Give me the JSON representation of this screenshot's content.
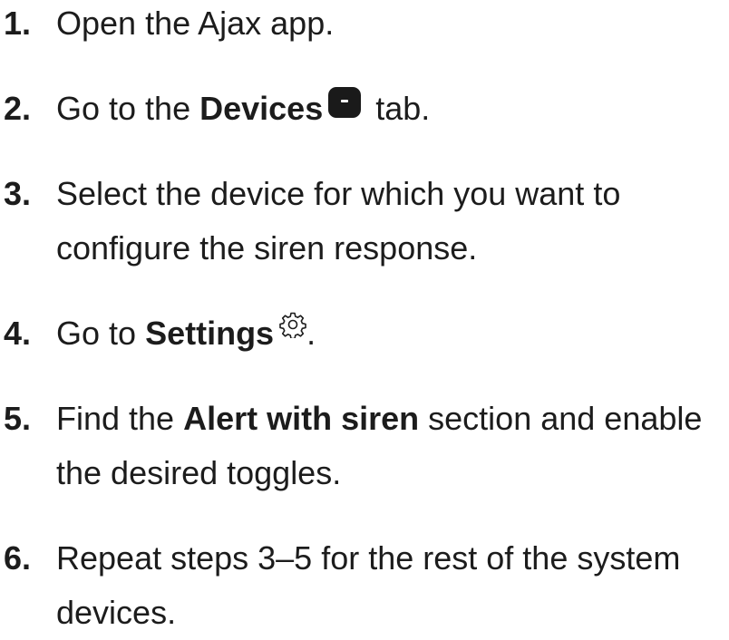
{
  "steps": [
    {
      "number": "1.",
      "text": "Open the Ajax app."
    },
    {
      "number": "2.",
      "before": "Go to the ",
      "bold": "Devices",
      "icon": "devices-tab-icon",
      "after": " tab."
    },
    {
      "number": "3.",
      "line1": "Select the device for which you want to",
      "line2": "configure the siren response."
    },
    {
      "number": "4.",
      "before": "Go to ",
      "bold": "Settings",
      "icon": "gear-icon",
      "after": "."
    },
    {
      "number": "5.",
      "before": "Find the ",
      "bold": "Alert with siren",
      "after_line1": " section and enable",
      "line2": "the desired toggles."
    },
    {
      "number": "6.",
      "line1": "Repeat steps 3–5 for the rest of the system",
      "line2": "devices."
    }
  ]
}
